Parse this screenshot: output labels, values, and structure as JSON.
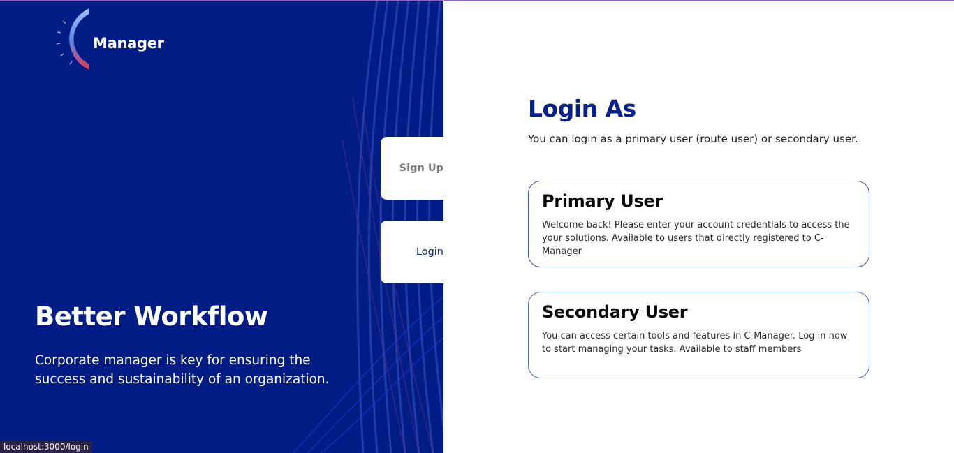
{
  "brand": {
    "name": "Manager",
    "colors": {
      "navy": "#001c85",
      "accent_blue": "#06208c",
      "logo_red": "#e8354f",
      "logo_blue": "#6aa0f0"
    }
  },
  "hero": {
    "title": "Better Workflow",
    "subtitle": "Corporate manager is key for ensuring the success and sustainability of an organization."
  },
  "tabs": {
    "signup_label": "Sign Up",
    "login_label": "Login"
  },
  "login": {
    "title": "Login As",
    "subtitle": "You can login as a primary user (route user) or secondary user.",
    "options": [
      {
        "title": "Primary User",
        "description": "Welcome back! Please enter your account credentials to access the your solutions. Available to users that directly registered to C-Manager"
      },
      {
        "title": "Secondary User",
        "description": "You can access certain tools and features in C-Manager. Log in now to start managing your tasks. Available to staff members"
      }
    ]
  },
  "status_bar": {
    "url": "localhost:3000/login"
  }
}
